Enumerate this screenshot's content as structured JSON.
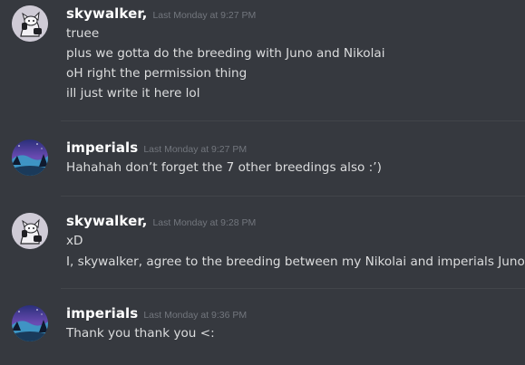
{
  "messages": [
    {
      "username": "skywalker,",
      "timestamp": "Last Monday at 9:27 PM",
      "avatar_icon": "cat-headphones-avatar",
      "lines": [
        "truee",
        "plus we gotta do the breeding with Juno and Nikolai",
        "oH right the permission thing",
        "ill just write it here lol"
      ]
    },
    {
      "username": "imperials",
      "timestamp": "Last Monday at 9:27 PM",
      "avatar_icon": "night-landscape-avatar",
      "lines": [
        "Hahahah don’t forget the 7 other breedings also :’)"
      ]
    },
    {
      "username": "skywalker,",
      "timestamp": "Last Monday at 9:28 PM",
      "avatar_icon": "cat-headphones-avatar",
      "lines": [
        "xD",
        "I, skywalker, agree to the breeding between my Nikolai and imperials Juno."
      ]
    },
    {
      "username": "imperials",
      "timestamp": "Last Monday at 9:36 PM",
      "avatar_icon": "night-landscape-avatar",
      "lines": [
        "Thank you thank you <:"
      ]
    }
  ],
  "colors": {
    "background": "#36393f",
    "username": "#ffffff",
    "message_text": "#dcddde",
    "timestamp": "#72767d",
    "divider": "#42454a"
  }
}
